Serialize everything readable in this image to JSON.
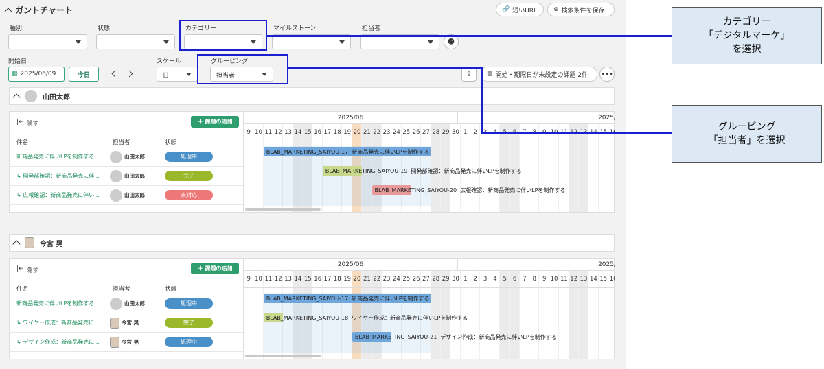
{
  "header": {
    "title": "ガントチャート",
    "short_url": "短いURL",
    "save_search": "検索条件を保存"
  },
  "filters": {
    "type_label": "種別",
    "status_label": "状態",
    "category_label": "カテゴリー",
    "milestone_label": "マイルストーン",
    "assignee_label": "担当者"
  },
  "controls": {
    "start_label": "開始日",
    "start_value": "2025/06/09",
    "today": "今日",
    "scale_label": "スケール",
    "scale_value": "日",
    "grouping_label": "グルーピング",
    "grouping_value": "担当者",
    "unset_issues": "開始・期限日が未設定の課題 2件"
  },
  "columns": {
    "hide": "隠す",
    "add_issue": "課題の追加",
    "name": "件名",
    "assignee": "担当者",
    "status": "状態"
  },
  "timeline": {
    "month1": "2025/06",
    "month2": "2025/",
    "days": [
      "9",
      "10",
      "11",
      "12",
      "13",
      "14",
      "15",
      "16",
      "17",
      "18",
      "19",
      "20",
      "21",
      "22",
      "23",
      "24",
      "25",
      "26",
      "27",
      "28",
      "29",
      "30",
      "1",
      "2",
      "3",
      "4",
      "5",
      "6",
      "7",
      "8",
      "9",
      "10",
      "11",
      "12",
      "13",
      "14",
      "15",
      "16"
    ]
  },
  "groups": [
    {
      "name": "山田太郎",
      "rows": [
        {
          "task": "新商品発売に伴いLPを制作する",
          "assignee": "山田太郎",
          "status": "処理中",
          "status_color": "#4a90c8",
          "bar_label": "BLAB_MARKETING_SAIYOU-17",
          "bar_desc": "新商品発売に伴いLPを制作する"
        },
        {
          "task": "↳ 開発部確認：新商品発売に伴...",
          "assignee": "山田太郎",
          "status": "完了",
          "status_color": "#9ab829",
          "bar_label": "BLAB_MARKETING_SAIYOU-19",
          "bar_desc": "開発部確認：新商品発売に伴いLPを制作する"
        },
        {
          "task": "↳ 広報確認：新商品発売に伴い...",
          "assignee": "山田太郎",
          "status": "未対応",
          "status_color": "#ec7878",
          "bar_label": "BLAB_MARKETING_SAIYOU-20",
          "bar_desc": "広報確認：新商品発売に伴いLPを制作する"
        }
      ]
    },
    {
      "name": "今宮 晃",
      "rows": [
        {
          "task": "新商品発売に伴いLPを制作する",
          "assignee": "山田太郎",
          "status": "処理中",
          "status_color": "#4a90c8",
          "bar_label": "BLAB_MARKETING_SAIYOU-17",
          "bar_desc": "新商品発売に伴いLPを制作する"
        },
        {
          "task": "↳ ワイヤー作成：新商品発売に...",
          "assignee": "今宮 晃",
          "status": "完了",
          "status_color": "#9ab829",
          "bar_label": "BLAB_MARKETING_SAIYOU-18",
          "bar_desc": "ワイヤー作成：新商品発売に伴いLPを制作する"
        },
        {
          "task": "↳ デザイン作成：新商品発売に...",
          "assignee": "今宮 晃",
          "status": "処理中",
          "status_color": "#4a90c8",
          "bar_label": "BLAB_MARKETING_SAIYOU-21",
          "bar_desc": "デザイン作成：新商品発売に伴いLPを制作する"
        }
      ]
    }
  ],
  "annotations": {
    "category": [
      "カテゴリー",
      "「デジタルマーケ」",
      "を選択"
    ],
    "grouping": [
      "グルーピング",
      "「担当者」を選択"
    ]
  },
  "colors": {
    "accent": "#2e9e6e",
    "highlight": "#1a1fcf",
    "annotation_bg": "#dce8f4"
  }
}
